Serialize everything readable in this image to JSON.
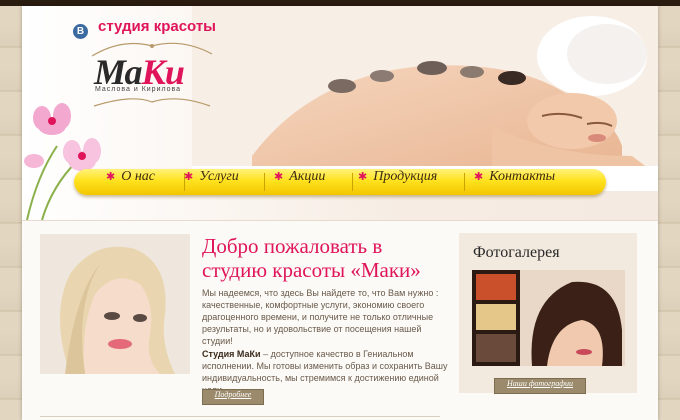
{
  "header": {
    "vk_icon_letter": "В",
    "tagline": "студия красоты",
    "logo": {
      "part1": "Ма",
      "part2": "Ки",
      "subtitle": "Маслова и Кирилова"
    }
  },
  "nav": {
    "items": [
      {
        "label": "О нас"
      },
      {
        "label": "Услуги"
      },
      {
        "label": "Акции"
      },
      {
        "label": "Продукция"
      },
      {
        "label": "Контакты"
      }
    ],
    "bullet": "✱"
  },
  "welcome": {
    "title": "Добро пожаловать в студию красоты «Маки»",
    "paragraph1": "Мы надеемся, что здесь Вы найдете то, что Вам нужно : качественные, комфортные услуги, экономию своего драгоценного времени, и получите не только отличные результаты, но и удовольствие от посещения нашей студии!",
    "paragraph2_bold": "Студия МаКи",
    "paragraph2_rest": " – доступное качество в Гениальном исполнении. Мы готовы изменить образ и сохранить Вашу индивидуальность, мы стремимся к достижению единой цели...",
    "more_button": "Подробнее"
  },
  "gallery": {
    "title": "Фотогалерея",
    "button": "Наши фотографии"
  },
  "colors": {
    "accent": "#e0145a",
    "nav_yellow": "#ffe21e",
    "button": "#9b8b6c"
  }
}
